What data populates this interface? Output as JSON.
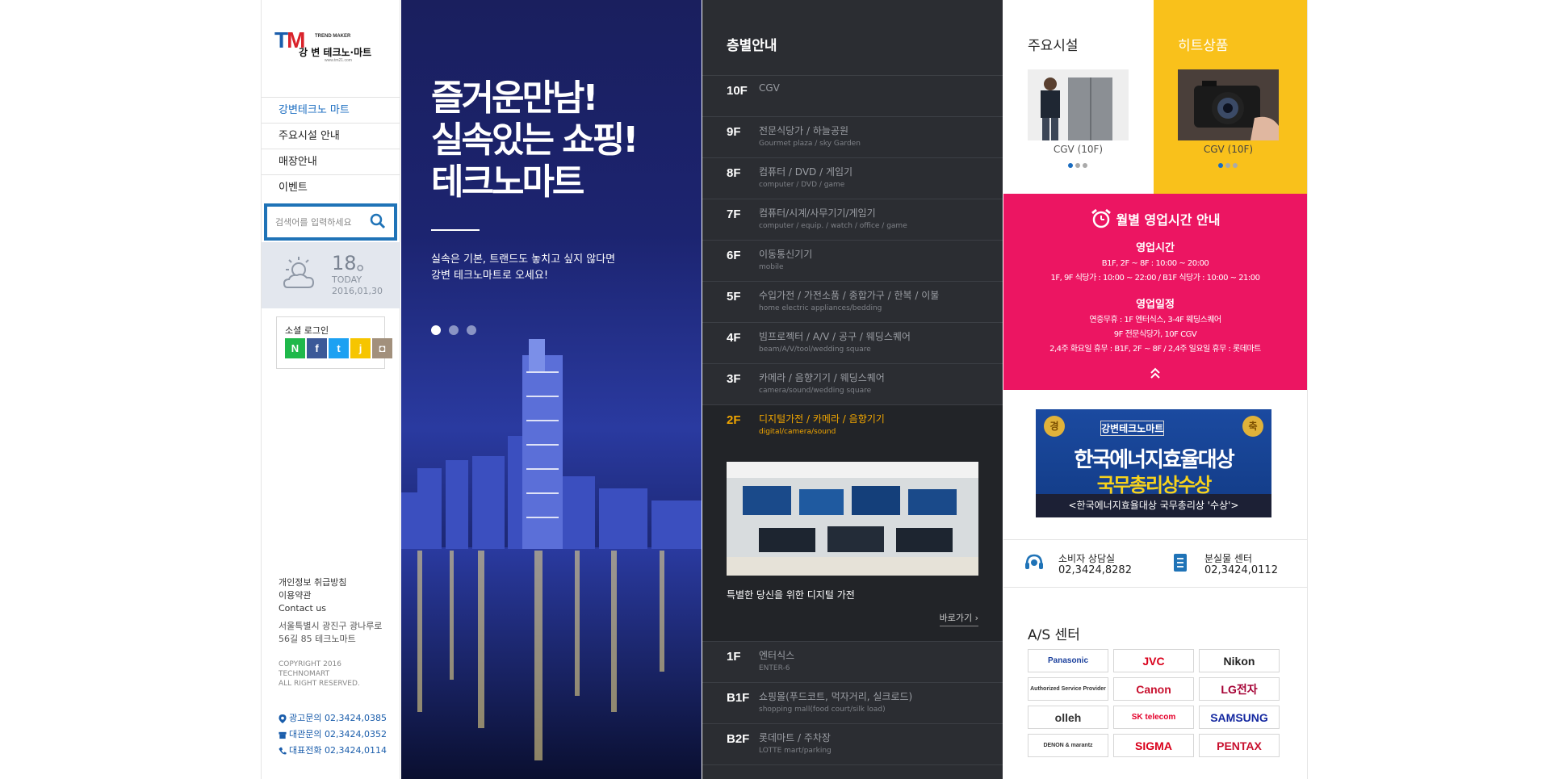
{
  "logo": {
    "mark_t": "T",
    "mark_m": "M",
    "trend_maker": "TREND MAKER",
    "name": "강 변 테크노·마트",
    "url": "www.tm21.com"
  },
  "nav": [
    "강변테크노 마트",
    "주요시설 안내",
    "매장안내",
    "이벤트"
  ],
  "search": {
    "placeholder": "검색어를 입력하세요"
  },
  "weather": {
    "temp": "18",
    "degree_mark": "。",
    "today": "TODAY",
    "date": "2016,01,30"
  },
  "social": {
    "title": "소셜 로그인",
    "items": [
      {
        "label": "N",
        "color": "#1fb84a"
      },
      {
        "label": "f",
        "color": "#3b5998"
      },
      {
        "label": "t",
        "color": "#1da1f2"
      },
      {
        "label": "j",
        "color": "#f6c500"
      },
      {
        "label": "◘",
        "color": "#a2907c"
      }
    ]
  },
  "footer": {
    "links": [
      "개인정보 취급방침",
      "이용약관",
      "Contact us"
    ],
    "address": [
      "서울특별시 광진구 광나루로",
      "56길 85 테크노마트"
    ],
    "copyright": [
      "COPYRIGHT 2016",
      "TECHNOMART",
      "ALL RIGHT RESERVED."
    ],
    "phones": [
      "광고문의 02,3424,0385",
      "대관문의 02,3424,0352",
      "대표전화 02,3424,0114"
    ]
  },
  "hero": {
    "headline": [
      "즐거운만남!",
      "실속있는 쇼핑!",
      "테크노마트"
    ],
    "sub": [
      "실속은 기본, 트랜드도 놓치고 싶지 않다면",
      "강변 테크노마트로 오세요!"
    ]
  },
  "floors": {
    "title": "층별안내",
    "selected": {
      "desc": "특별한 당신을 위한 디지털 가전",
      "more": "바로가기 ›"
    },
    "items": [
      {
        "floor": "10F",
        "ko": "CGV",
        "en": ""
      },
      {
        "floor": "9F",
        "ko": "전문식당가 / 하늘공원",
        "en": "Gourmet plaza / sky Garden"
      },
      {
        "floor": "8F",
        "ko": "컴퓨터 / DVD / 게임기",
        "en": "computer / DVD / game"
      },
      {
        "floor": "7F",
        "ko": "컴퓨터/시계/사무기기/게임기",
        "en": "computer / equip. / watch / office / game"
      },
      {
        "floor": "6F",
        "ko": "이동통신기기",
        "en": "mobile"
      },
      {
        "floor": "5F",
        "ko": "수입가전 / 가전소품 / 종합가구 / 한복 / 이불",
        "en": "home electric appliances/bedding"
      },
      {
        "floor": "4F",
        "ko": "빔프로젝터 / A/V / 공구 / 웨딩스퀘어",
        "en": "beam/A/V/tool/wedding square"
      },
      {
        "floor": "3F",
        "ko": "카메라 / 음향기기 / 웨딩스퀘어",
        "en": "camera/sound/wedding square"
      },
      {
        "floor": "2F",
        "ko": "디지털가전 / 카메라 / 음향기기",
        "en": "digital/camera/sound"
      },
      {
        "floor": "1F",
        "ko": "엔터식스",
        "en": "ENTER-6"
      },
      {
        "floor": "B1F",
        "ko": "쇼핑몰(푸드코트, 먹자거리, 실크로드)",
        "en": "shopping mall(food court/silk load)"
      },
      {
        "floor": "B2F",
        "ko": "롯데마트 / 주차장",
        "en": "LOTTE mart/parking"
      }
    ]
  },
  "facilities": {
    "title": "주요시설",
    "caption": "CGV (10F)"
  },
  "hit": {
    "title": "히트상품",
    "caption": "CGV (10F)"
  },
  "hours": {
    "title": "월별 영업시간 안내",
    "sections": [
      {
        "heading": "영업시간",
        "lines": [
          "B1F, 2F ~ 8F : 10:00 ~ 20:00",
          "1F, 9F 식당가 : 10:00 ~ 22:00 / B1F 식당가 : 10:00 ~ 21:00"
        ]
      },
      {
        "heading": "영업일정",
        "lines": [
          "연중무휴 : 1F 엔터식스, 3-4F 웨딩스퀘어",
          "9F 전문식당가, 10F CGV",
          "2,4주 화요일 휴무 : B1F, 2F ~ 8F / 2,4주 일요일 휴무 : 롯데마트"
        ]
      }
    ]
  },
  "award": {
    "seal_left": "경",
    "seal_right": "축",
    "brand": "강변테크노마트",
    "line1": "한국에너지효율대상",
    "line2": "국무총리상수상",
    "bar": "<한국에너지효율대상 국무총리상 '수상'>"
  },
  "contacts": [
    {
      "label": "소비자 상담실",
      "number": "02,3424,8282"
    },
    {
      "label": "분실물 센터",
      "number": "02,3424,0112"
    }
  ],
  "as_center": {
    "title": "A/S 센터",
    "brands": [
      {
        "name": "Panasonic",
        "color": "#1a3f9c"
      },
      {
        "name": "JVC",
        "color": "#d9001b"
      },
      {
        "name": "Nikon",
        "color": "#222222"
      },
      {
        "name": "Authorized Service Provider",
        "color": "#333333"
      },
      {
        "name": "Canon",
        "color": "#c8102e"
      },
      {
        "name": "LG전자",
        "color": "#a50034"
      },
      {
        "name": "olleh",
        "color": "#333333"
      },
      {
        "name": "SK telecom",
        "color": "#e4002b"
      },
      {
        "name": "SAMSUNG",
        "color": "#1428a0"
      },
      {
        "name": "DENON & marantz",
        "color": "#333333"
      },
      {
        "name": "SIGMA",
        "color": "#d9001b"
      },
      {
        "name": "PENTAX",
        "color": "#c8102e"
      }
    ]
  }
}
